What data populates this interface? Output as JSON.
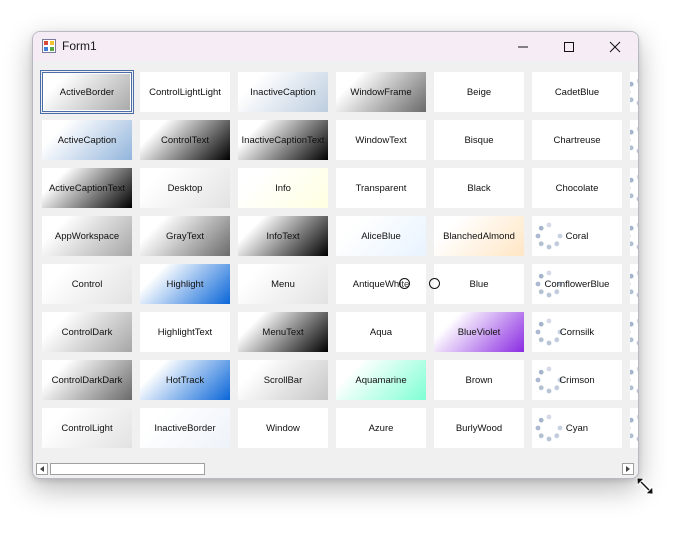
{
  "window": {
    "title": "Form1",
    "icons": {
      "app": "form-app-icon",
      "minimize": "minimize-icon",
      "maximize": "maximize-icon",
      "close": "close-icon"
    }
  },
  "tiles": [
    {
      "name": "ActiveBorder",
      "style": "grad-gray",
      "selected": true
    },
    {
      "name": "ActiveCaption",
      "style": "grad-blue-light"
    },
    {
      "name": "ActiveCaptionText",
      "style": "grad-black"
    },
    {
      "name": "AppWorkspace",
      "style": "grad-gray"
    },
    {
      "name": "Control",
      "style": "grad-light"
    },
    {
      "name": "ControlDark",
      "style": "grad-gray"
    },
    {
      "name": "ControlDarkDark",
      "style": "grad-darkgray"
    },
    {
      "name": "ControlLight",
      "style": "grad-light"
    },
    {
      "name": "ControlLightLight",
      "style": "plain"
    },
    {
      "name": "ControlText",
      "style": "grad-black"
    },
    {
      "name": "Desktop",
      "style": "grad-light"
    },
    {
      "name": "GrayText",
      "style": "grad-darkgray"
    },
    {
      "name": "Highlight",
      "style": "grad-blue"
    },
    {
      "name": "HighlightText",
      "style": "plain"
    },
    {
      "name": "HotTrack",
      "style": "grad-blue"
    },
    {
      "name": "InactiveBorder",
      "style": "grad-faintblue"
    },
    {
      "name": "InactiveCaption",
      "style": "grad-blue-gray"
    },
    {
      "name": "InactiveCaptionText",
      "style": "grad-black"
    },
    {
      "name": "Info",
      "style": "grad-yellow"
    },
    {
      "name": "InfoText",
      "style": "grad-black"
    },
    {
      "name": "Menu",
      "style": "grad-light"
    },
    {
      "name": "MenuText",
      "style": "grad-black"
    },
    {
      "name": "ScrollBar",
      "style": "grad-midgray"
    },
    {
      "name": "Window",
      "style": "plain"
    },
    {
      "name": "WindowFrame",
      "style": "grad-darkgray"
    },
    {
      "name": "WindowText",
      "style": "plain"
    },
    {
      "name": "Transparent",
      "style": "plain"
    },
    {
      "name": "AliceBlue",
      "style": "grad-aliceblue"
    },
    {
      "name": "AntiqueWhite",
      "style": "plain"
    },
    {
      "name": "Aqua",
      "style": "plain"
    },
    {
      "name": "Aquamarine",
      "style": "grad-aquamarine"
    },
    {
      "name": "Azure",
      "style": "plain"
    },
    {
      "name": "Beige",
      "style": "plain"
    },
    {
      "name": "Bisque",
      "style": "plain"
    },
    {
      "name": "Black",
      "style": "plain"
    },
    {
      "name": "BlanchedAlmond",
      "style": "grad-almond"
    },
    {
      "name": "Blue",
      "style": "plain"
    },
    {
      "name": "BlueViolet",
      "style": "grad-violet"
    },
    {
      "name": "Brown",
      "style": "plain"
    },
    {
      "name": "BurlyWood",
      "style": "plain"
    },
    {
      "name": "CadetBlue",
      "style": "plain"
    },
    {
      "name": "Chartreuse",
      "style": "plain"
    },
    {
      "name": "Chocolate",
      "style": "plain"
    },
    {
      "name": "Coral",
      "style": "plain",
      "loading": true
    },
    {
      "name": "CornflowerBlue",
      "style": "plain",
      "loading": true
    },
    {
      "name": "Cornsilk",
      "style": "plain",
      "loading": true
    },
    {
      "name": "Crimson",
      "style": "plain",
      "loading": true
    },
    {
      "name": "Cyan",
      "style": "plain",
      "loading": true
    }
  ],
  "colors": {
    "grad-gray": [
      "#ffffff",
      "#a6a6a6"
    ],
    "grad-light": [
      "#ffffff",
      "#e2e2e2"
    ],
    "grad-darkgray": [
      "#ffffff",
      "#6a6a6a"
    ],
    "grad-midgray": [
      "#ffffff",
      "#c6c6c6"
    ],
    "grad-black": [
      "#ffffff",
      "#000000"
    ],
    "grad-blue": [
      "#ffffff",
      "#0a66d8"
    ],
    "grad-blue-light": [
      "#ffffff",
      "#93b5dc"
    ],
    "grad-blue-gray": [
      "#ffffff",
      "#bccddf"
    ],
    "grad-faintblue": [
      "#ffffff",
      "#eef3fa"
    ],
    "grad-yellow": [
      "#ffffff",
      "#ffffe1"
    ],
    "grad-aliceblue": [
      "#ffffff",
      "#e8f3ff"
    ],
    "grad-aquamarine": [
      "#ffffff",
      "#7fffd4"
    ],
    "grad-almond": [
      "#ffffff",
      "#ffe6c4"
    ],
    "grad-violet": [
      "#ffffff",
      "#8a2be2"
    ],
    "plain": [
      "#ffffff",
      "#ffffff"
    ],
    "titlebar": "#f5ecf5",
    "form_background": "#f0f0f0",
    "loader_dot": "#9fb0c8"
  },
  "scrollbar": {
    "left_icon": "scroll-left-icon",
    "right_icon": "scroll-right-icon"
  },
  "cursor": {
    "resize_icon": "resize-diagonal-icon"
  }
}
